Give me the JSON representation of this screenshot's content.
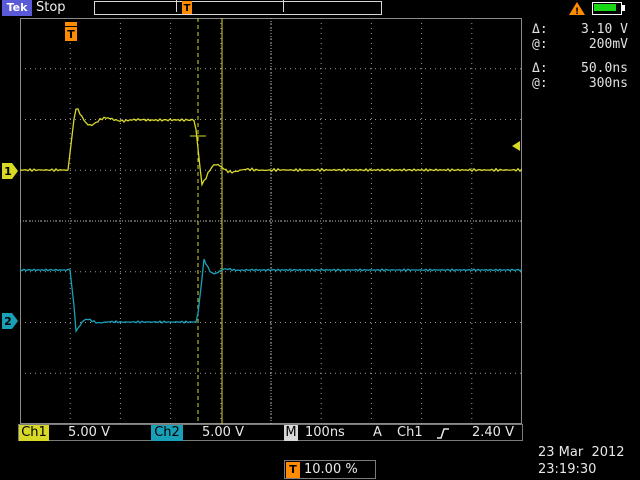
{
  "header": {
    "brand": "Tek",
    "acquisition_status": "Stop",
    "trigger_marker_icon": "trigger-T-icon",
    "battery_icon": "battery-icon",
    "warning_icon": "warning-triangle-icon"
  },
  "cursor_readouts": {
    "voltage_delta_symbol": "Δ:",
    "voltage_delta": "3.10 V",
    "voltage_at_symbol": "@:",
    "voltage_at": "200mV",
    "time_delta_symbol": "Δ:",
    "time_delta": "50.0ns",
    "time_at_symbol": "@:",
    "time_at": "300ns"
  },
  "channel_markers": {
    "ch1": "1",
    "ch2": "2",
    "trigger": "T"
  },
  "status_bar": {
    "ch1_label": "Ch1",
    "ch1_scale": "5.00 V",
    "ch2_label": "Ch2",
    "ch2_scale": "5.00 V",
    "timebase_label": "M",
    "timebase": "100ns",
    "trigger_mode": "A",
    "trigger_source": "Ch1",
    "trigger_slope_icon": "rising-edge-icon",
    "trigger_level": "2.40 V",
    "trigger_position_label": "T",
    "trigger_position": "10.00 %"
  },
  "datetime": {
    "date": "23 Mar  2012",
    "time": "23:19:30"
  },
  "colors": {
    "ch1": "#d8d826",
    "ch2": "#18a0b8",
    "accent": "#ff8c00",
    "graticule": "#b0b0b0"
  }
}
